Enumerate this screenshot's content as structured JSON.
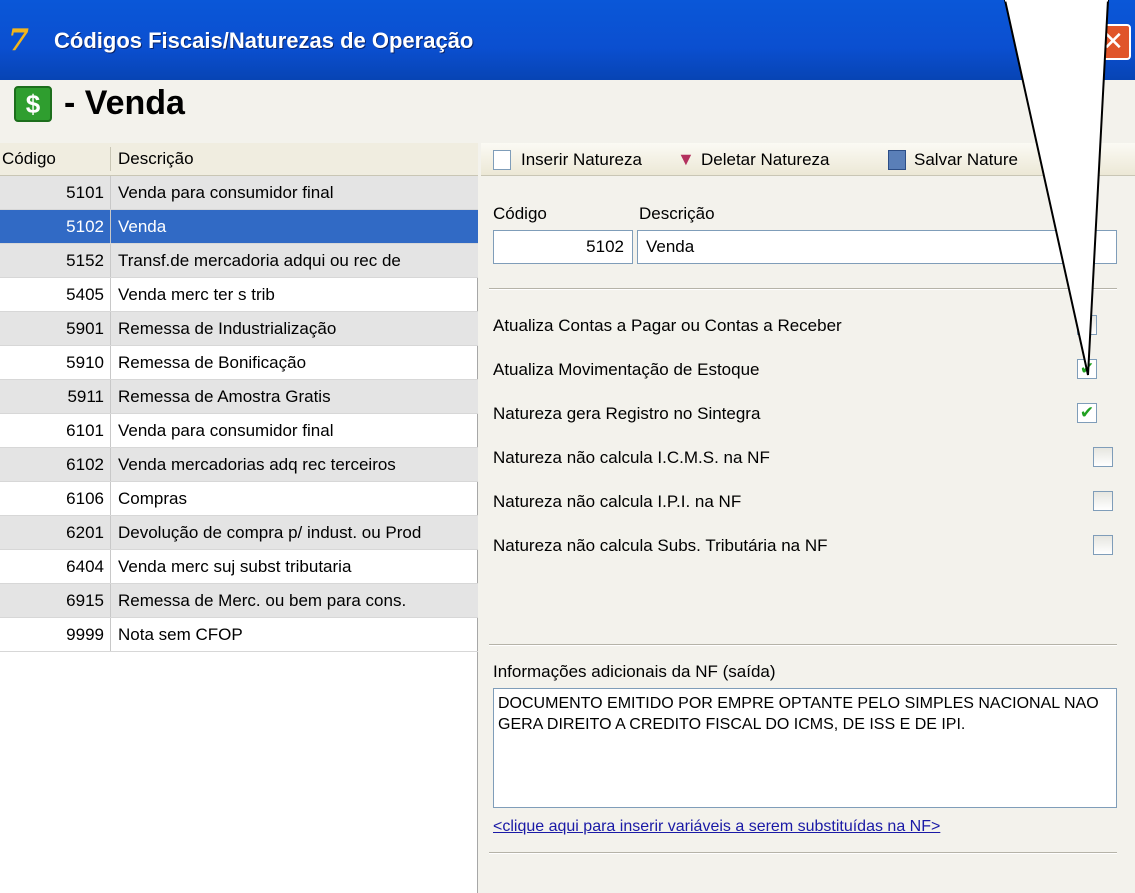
{
  "window": {
    "title": "Códigos Fiscais/Naturezas de Operação",
    "icon_glyph": "7",
    "close_glyph": "✕"
  },
  "header": {
    "icon_glyph": "$",
    "title": "- Venda"
  },
  "list": {
    "columns": {
      "code": "Código",
      "description": "Descrição"
    },
    "rows": [
      {
        "code": "5101",
        "description": "Venda para consumidor final"
      },
      {
        "code": "5102",
        "description": "Venda"
      },
      {
        "code": "5152",
        "description": "Transf.de mercadoria adqui ou rec de"
      },
      {
        "code": "5405",
        "description": "Venda merc ter s trib"
      },
      {
        "code": "5901",
        "description": "Remessa de Industrialização"
      },
      {
        "code": "5910",
        "description": "Remessa de Bonificação"
      },
      {
        "code": "5911",
        "description": "Remessa de Amostra Gratis"
      },
      {
        "code": "6101",
        "description": "Venda para consumidor final"
      },
      {
        "code": "6102",
        "description": "Venda mercadorias adq  rec terceiros"
      },
      {
        "code": "6106",
        "description": "Compras"
      },
      {
        "code": "6201",
        "description": "Devolução de compra p/ indust. ou Prod"
      },
      {
        "code": "6404",
        "description": "Venda merc suj subst tributaria"
      },
      {
        "code": "6915",
        "description": "Remessa de Merc. ou bem para cons."
      },
      {
        "code": "9999",
        "description": "Nota sem CFOP"
      }
    ],
    "selected_code": "5102"
  },
  "toolbar": {
    "insert_label": "Inserir Natureza",
    "delete_label": "Deletar Natureza",
    "save_label": "Salvar Nature"
  },
  "form": {
    "code_label": "Código",
    "description_label": "Descrição",
    "code_value": "5102",
    "description_value": "Venda",
    "options": [
      {
        "label": "Atualiza Contas a Pagar ou Contas a Receber",
        "checked": false
      },
      {
        "label": "Atualiza Movimentação de Estoque",
        "checked": true
      },
      {
        "label": "Natureza gera Registro no Sintegra",
        "checked": true
      },
      {
        "label": "Natureza não calcula I.C.M.S. na NF",
        "checked": false
      },
      {
        "label": "Natureza não calcula I.P.I. na NF",
        "checked": false
      },
      {
        "label": "Natureza não calcula Subs. Tributária na NF",
        "checked": false
      }
    ],
    "check_glyph": "✔",
    "info_label": "Informações adicionais da NF (saída)",
    "info_text": "DOCUMENTO EMITIDO POR EMPRE OPTANTE PELO SIMPLES NACIONAL NAO GERA DIREITO A CREDITO FISCAL DO ICMS, DE ISS E DE IPI.",
    "variables_link": "<clique aqui para inserir variáveis a serem substituídas na NF>"
  },
  "colors": {
    "titlebar": "#0a57d8",
    "selection": "#316ac5",
    "check": "#21a121"
  }
}
